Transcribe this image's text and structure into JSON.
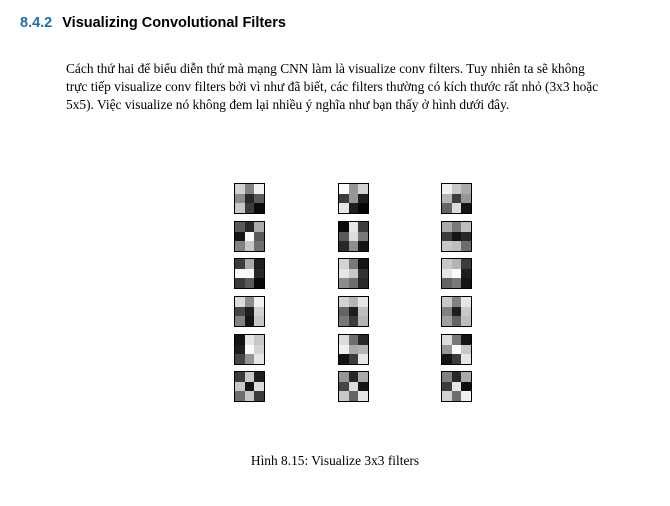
{
  "section": {
    "number": "8.4.2",
    "title": "Visualizing Convolutional Filters"
  },
  "paragraph_lines": [
    "Cách thứ hai để biểu diễn thứ mà mạng CNN làm là visualize conv filters. Tuy nhiên ta sẽ không",
    "trực tiếp visualize conv filters bởi vì như đã biết, các filters thường có kích thước rất nhỏ (3x3 hoặc",
    "5x5). Việc visualize nó không đem lại nhiều ý nghĩa như bạn thấy ở hình dưới đây."
  ],
  "figure": {
    "caption": "Hình 8.15: Visualize 3x3 filters",
    "columns": 3,
    "rows": 6,
    "filters": [
      [
        [
          210,
          130,
          240
        ],
        [
          140,
          40,
          90
        ],
        [
          200,
          60,
          10
        ]
      ],
      [
        [
          250,
          150,
          210
        ],
        [
          60,
          150,
          30
        ],
        [
          230,
          30,
          5
        ]
      ],
      [
        [
          240,
          200,
          170
        ],
        [
          180,
          60,
          150
        ],
        [
          100,
          220,
          20
        ]
      ],
      [
        [
          90,
          40,
          170
        ],
        [
          20,
          250,
          90
        ],
        [
          130,
          200,
          110
        ]
      ],
      [
        [
          10,
          230,
          60
        ],
        [
          90,
          220,
          120
        ],
        [
          40,
          140,
          20
        ]
      ],
      [
        [
          170,
          120,
          190
        ],
        [
          60,
          20,
          40
        ],
        [
          200,
          190,
          110
        ]
      ],
      [
        [
          60,
          170,
          30
        ],
        [
          250,
          250,
          40
        ],
        [
          60,
          90,
          10
        ]
      ],
      [
        [
          210,
          120,
          20
        ],
        [
          230,
          200,
          50
        ],
        [
          140,
          110,
          40
        ]
      ],
      [
        [
          200,
          180,
          60
        ],
        [
          230,
          250,
          30
        ],
        [
          100,
          120,
          20
        ]
      ],
      [
        [
          220,
          140,
          240
        ],
        [
          70,
          30,
          210
        ],
        [
          130,
          20,
          200
        ]
      ],
      [
        [
          210,
          180,
          230
        ],
        [
          100,
          30,
          190
        ],
        [
          120,
          60,
          180
        ]
      ],
      [
        [
          200,
          130,
          230
        ],
        [
          130,
          30,
          200
        ],
        [
          160,
          100,
          190
        ]
      ],
      [
        [
          20,
          230,
          200
        ],
        [
          30,
          250,
          210
        ],
        [
          70,
          150,
          230
        ]
      ],
      [
        [
          220,
          110,
          40
        ],
        [
          240,
          170,
          180
        ],
        [
          20,
          60,
          230
        ]
      ],
      [
        [
          220,
          120,
          20
        ],
        [
          150,
          250,
          200
        ],
        [
          20,
          60,
          230
        ]
      ],
      [
        [
          60,
          200,
          30
        ],
        [
          200,
          20,
          220
        ],
        [
          110,
          200,
          60
        ]
      ],
      [
        [
          150,
          40,
          170
        ],
        [
          70,
          220,
          20
        ],
        [
          200,
          100,
          230
        ]
      ],
      [
        [
          130,
          40,
          170
        ],
        [
          60,
          230,
          10
        ],
        [
          210,
          110,
          240
        ]
      ]
    ]
  }
}
